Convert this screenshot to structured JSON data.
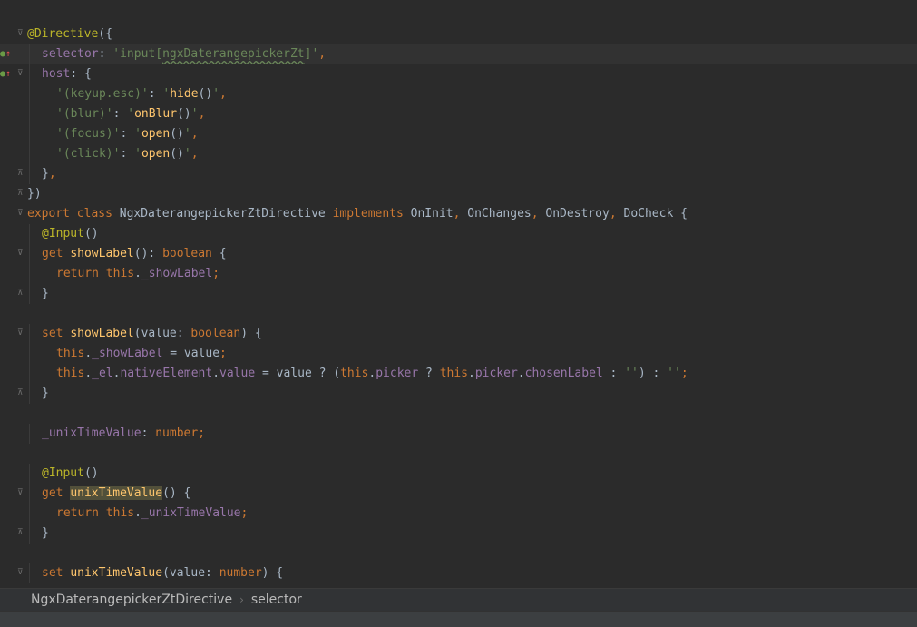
{
  "editor": {
    "current_line": 1,
    "lines": [
      {
        "indent": 0,
        "fold": "open",
        "tokens": [
          [
            "d",
            "@Directive"
          ],
          [
            "t",
            "({"
          ]
        ]
      },
      {
        "indent": 1,
        "marker": true,
        "tokens": [
          [
            "p",
            "selector"
          ],
          [
            "t",
            ": "
          ],
          [
            "s",
            "'input["
          ],
          [
            "sw",
            "ngxDaterangepickerZt"
          ],
          [
            "s",
            "]'"
          ],
          [
            "k",
            ","
          ]
        ]
      },
      {
        "indent": 1,
        "marker": true,
        "fold": "open",
        "tokens": [
          [
            "p",
            "host"
          ],
          [
            "t",
            ": {"
          ]
        ]
      },
      {
        "indent": 2,
        "tokens": [
          [
            "s",
            "'(keyup.esc)'"
          ],
          [
            "t",
            ": "
          ],
          [
            "s",
            "'"
          ],
          [
            "f",
            "hide"
          ],
          [
            "t",
            "()"
          ],
          [
            "s",
            "'"
          ],
          [
            "k",
            ","
          ]
        ]
      },
      {
        "indent": 2,
        "tokens": [
          [
            "s",
            "'(blur)'"
          ],
          [
            "t",
            ": "
          ],
          [
            "s",
            "'"
          ],
          [
            "f",
            "onBlur"
          ],
          [
            "t",
            "()"
          ],
          [
            "s",
            "'"
          ],
          [
            "k",
            ","
          ]
        ]
      },
      {
        "indent": 2,
        "tokens": [
          [
            "s",
            "'(focus)'"
          ],
          [
            "t",
            ": "
          ],
          [
            "s",
            "'"
          ],
          [
            "f",
            "open"
          ],
          [
            "t",
            "()"
          ],
          [
            "s",
            "'"
          ],
          [
            "k",
            ","
          ]
        ]
      },
      {
        "indent": 2,
        "tokens": [
          [
            "s",
            "'(click)'"
          ],
          [
            "t",
            ": "
          ],
          [
            "s",
            "'"
          ],
          [
            "f",
            "open"
          ],
          [
            "t",
            "()"
          ],
          [
            "s",
            "'"
          ],
          [
            "k",
            ","
          ]
        ]
      },
      {
        "indent": 1,
        "fold": "close",
        "tokens": [
          [
            "t",
            "}"
          ],
          [
            "k",
            ","
          ]
        ]
      },
      {
        "indent": 0,
        "fold": "close",
        "tokens": [
          [
            "t",
            "})"
          ]
        ]
      },
      {
        "indent": 0,
        "fold": "open",
        "tokens": [
          [
            "k",
            "export class "
          ],
          [
            "t",
            "NgxDaterangepickerZtDirective "
          ],
          [
            "k",
            "implements "
          ],
          [
            "t",
            "OnInit"
          ],
          [
            "k",
            ", "
          ],
          [
            "t",
            "OnChanges"
          ],
          [
            "k",
            ", "
          ],
          [
            "t",
            "OnDestroy"
          ],
          [
            "k",
            ", "
          ],
          [
            "t",
            "DoCheck {"
          ]
        ]
      },
      {
        "indent": 1,
        "tokens": [
          [
            "d",
            "@Input"
          ],
          [
            "t",
            "()"
          ]
        ]
      },
      {
        "indent": 1,
        "fold": "open",
        "tokens": [
          [
            "k",
            "get "
          ],
          [
            "f",
            "showLabel"
          ],
          [
            "t",
            "(): "
          ],
          [
            "k",
            "boolean "
          ],
          [
            "t",
            "{"
          ]
        ]
      },
      {
        "indent": 2,
        "tokens": [
          [
            "k",
            "return this"
          ],
          [
            "t",
            "."
          ],
          [
            "p",
            "_showLabel"
          ],
          [
            "k",
            ";"
          ]
        ]
      },
      {
        "indent": 1,
        "fold": "close",
        "tokens": [
          [
            "t",
            "}"
          ]
        ]
      },
      {
        "indent": 1,
        "tokens": []
      },
      {
        "indent": 1,
        "fold": "open",
        "tokens": [
          [
            "k",
            "set "
          ],
          [
            "f",
            "showLabel"
          ],
          [
            "t",
            "(value: "
          ],
          [
            "k",
            "boolean"
          ],
          [
            "t",
            ") {"
          ]
        ]
      },
      {
        "indent": 2,
        "tokens": [
          [
            "k",
            "this"
          ],
          [
            "t",
            "."
          ],
          [
            "p",
            "_showLabel"
          ],
          [
            "t",
            " = value"
          ],
          [
            "k",
            ";"
          ]
        ]
      },
      {
        "indent": 2,
        "tokens": [
          [
            "k",
            "this"
          ],
          [
            "t",
            "."
          ],
          [
            "p",
            "_el"
          ],
          [
            "t",
            "."
          ],
          [
            "p",
            "nativeElement"
          ],
          [
            "t",
            "."
          ],
          [
            "p",
            "value"
          ],
          [
            "t",
            " = value ? ("
          ],
          [
            "k",
            "this"
          ],
          [
            "t",
            "."
          ],
          [
            "p",
            "picker"
          ],
          [
            "t",
            " ? "
          ],
          [
            "k",
            "this"
          ],
          [
            "t",
            "."
          ],
          [
            "p",
            "picker"
          ],
          [
            "t",
            "."
          ],
          [
            "p",
            "chosenLabel"
          ],
          [
            "t",
            " : "
          ],
          [
            "s",
            "''"
          ],
          [
            "t",
            ") : "
          ],
          [
            "s",
            "''"
          ],
          [
            "k",
            ";"
          ]
        ]
      },
      {
        "indent": 1,
        "fold": "close",
        "tokens": [
          [
            "t",
            "}"
          ]
        ]
      },
      {
        "indent": 1,
        "tokens": []
      },
      {
        "indent": 1,
        "tokens": [
          [
            "p",
            "_unixTimeValue"
          ],
          [
            "t",
            ": "
          ],
          [
            "k",
            "number;"
          ]
        ]
      },
      {
        "indent": 1,
        "tokens": []
      },
      {
        "indent": 1,
        "tokens": [
          [
            "d",
            "@Input"
          ],
          [
            "t",
            "()"
          ]
        ]
      },
      {
        "indent": 1,
        "fold": "open",
        "tokens": [
          [
            "k",
            "get "
          ],
          [
            "fh",
            "unixTimeValue"
          ],
          [
            "t",
            "() {"
          ]
        ]
      },
      {
        "indent": 2,
        "tokens": [
          [
            "k",
            "return this"
          ],
          [
            "t",
            "."
          ],
          [
            "p",
            "_unixTimeValue"
          ],
          [
            "k",
            ";"
          ]
        ]
      },
      {
        "indent": 1,
        "fold": "close",
        "tokens": [
          [
            "t",
            "}"
          ]
        ]
      },
      {
        "indent": 1,
        "tokens": []
      },
      {
        "indent": 1,
        "fold": "open",
        "tokens": [
          [
            "k",
            "set "
          ],
          [
            "f",
            "unixTimeValue"
          ],
          [
            "t",
            "(value: "
          ],
          [
            "k",
            "number"
          ],
          [
            "t",
            ") {"
          ]
        ]
      }
    ]
  },
  "breadcrumb": {
    "items": [
      "NgxDaterangepickerZtDirective",
      "selector"
    ],
    "separator": "›"
  },
  "colors": {
    "keyword": "#cc7832",
    "string": "#6a8759",
    "property": "#9876aa",
    "decorator": "#bbb529",
    "function": "#ffc66d",
    "text": "#a9b7c6",
    "background": "#2b2b2b"
  }
}
